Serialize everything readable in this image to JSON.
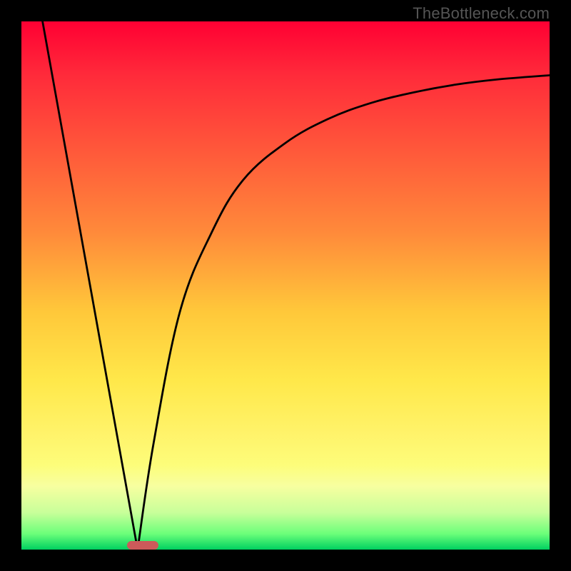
{
  "attribution": "TheBottleneck.com",
  "chart_data": {
    "type": "line",
    "title": "",
    "xlabel": "",
    "ylabel": "",
    "xlim": [
      0,
      100
    ],
    "ylim": [
      0,
      100
    ],
    "series": [
      {
        "name": "left-line",
        "x": [
          4,
          22
        ],
        "y": [
          100,
          0
        ]
      },
      {
        "name": "right-curve",
        "x": [
          22,
          25,
          30,
          36,
          42,
          50,
          58,
          66,
          74,
          82,
          90,
          100
        ],
        "y": [
          0,
          20,
          45,
          60,
          70,
          77,
          81.5,
          84.5,
          86.5,
          88,
          89,
          89.8
        ]
      }
    ],
    "marker": {
      "x_start": 20,
      "x_end": 26,
      "y": 0
    }
  }
}
